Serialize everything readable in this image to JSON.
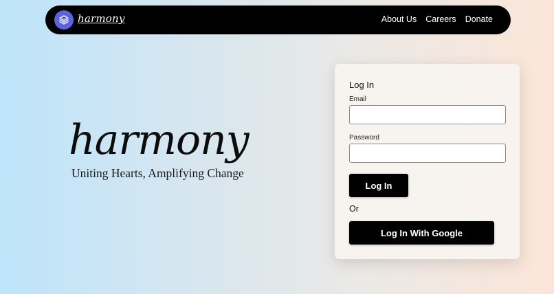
{
  "navbar": {
    "brand": "harmony",
    "logo_icon": "layers-icon",
    "links": [
      "About Us",
      "Careers",
      "Donate"
    ]
  },
  "hero": {
    "title": "harmony",
    "tagline": "Uniting Hearts, Amplifying Change"
  },
  "login": {
    "heading": "Log In",
    "email_label": "Email",
    "email_value": "",
    "password_label": "Password",
    "password_value": "",
    "submit_label": "Log In",
    "or_text": "Or",
    "google_label": "Log In With Google"
  },
  "colors": {
    "logo_circle": "#5b63e0",
    "navbar_bg": "#000000",
    "button_bg": "#000000"
  }
}
